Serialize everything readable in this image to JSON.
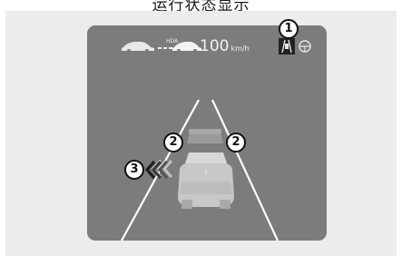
{
  "header": {
    "title": "运行状态显示"
  },
  "hud": {
    "hda_label": "HDA",
    "speed_value": "100",
    "speed_unit": "km/h"
  },
  "callouts": {
    "c1": "1",
    "c2a": "2",
    "c2b": "2",
    "c3": "3"
  },
  "icons": {
    "vehicle_ahead": "car-silhouette-icon",
    "host_vehicle_small": "car-silhouette-icon",
    "lane_keep": "lane-keeping-icon",
    "steering_status": "steering-wheel-icon",
    "lane_change": "lane-change-chevrons-icon"
  },
  "colors": {
    "screen": "#7c7c7c",
    "panel": "#ececec",
    "lane_line": "#ffffff",
    "callout_border": "#111111"
  }
}
